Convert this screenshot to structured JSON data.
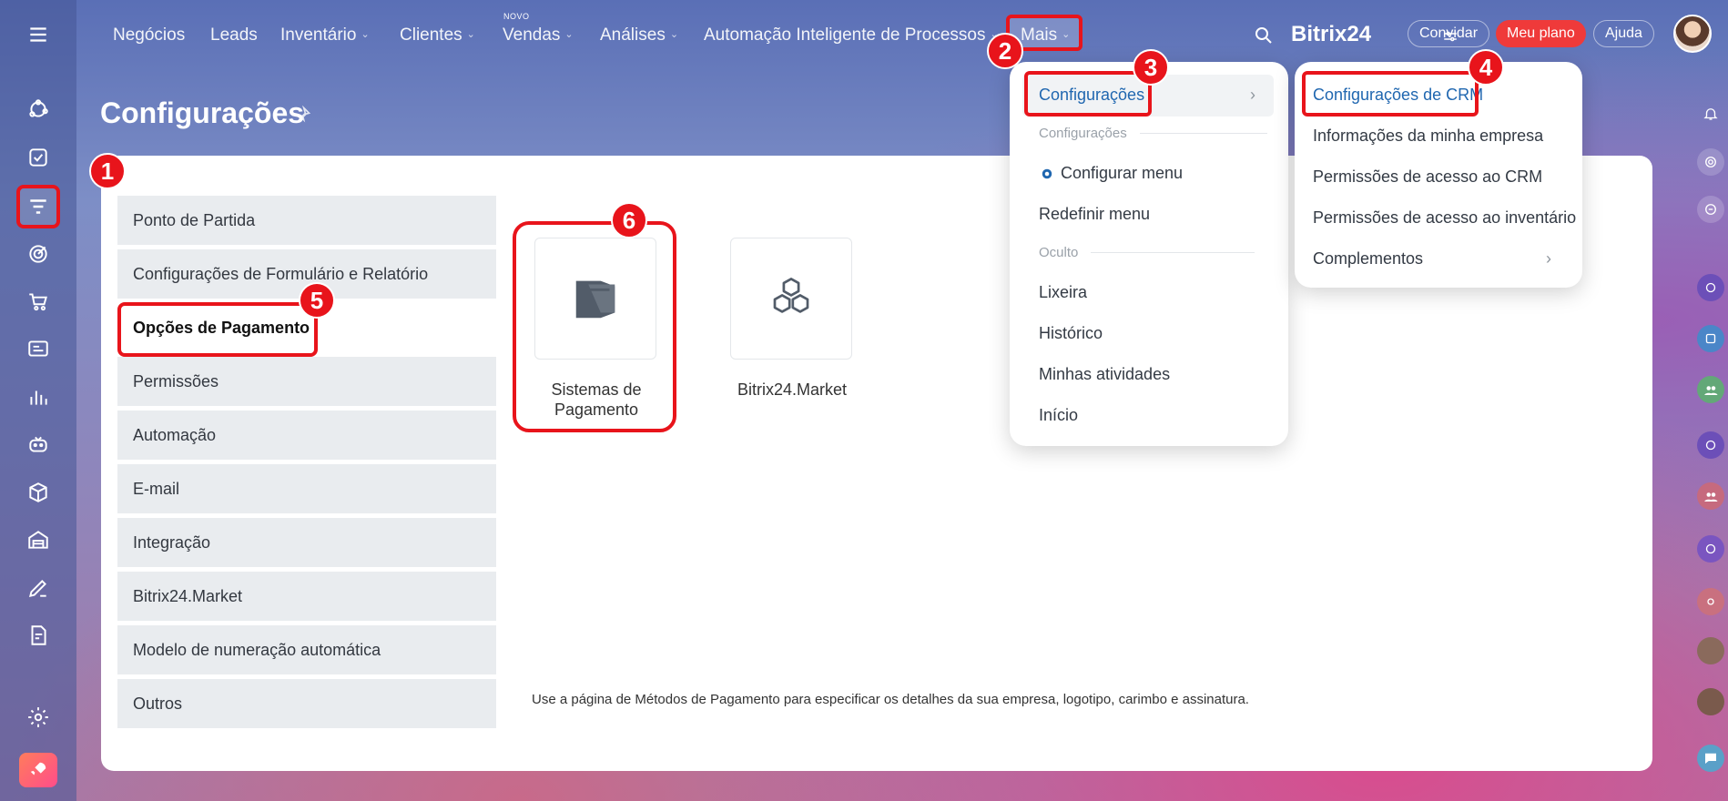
{
  "nav": {
    "items": [
      {
        "label": "Negócios",
        "chevron": false
      },
      {
        "label": "Leads",
        "chevron": false
      },
      {
        "label": "Inventário",
        "chevron": true
      },
      {
        "label": "Clientes",
        "chevron": true
      },
      {
        "label": "Vendas",
        "chevron": true
      },
      {
        "label": "Análises",
        "chevron": true
      },
      {
        "label": "Automação Inteligente de Processos",
        "chevron": true
      },
      {
        "label": "Mais",
        "chevron": true
      }
    ],
    "new_tag": "NOVO",
    "brand": "Bitrix24",
    "invite": "Convidar",
    "plan": "Meu plano",
    "help": "Ajuda"
  },
  "page": {
    "title": "Configurações"
  },
  "menu": {
    "items": [
      "Ponto de Partida",
      "Configurações de Formulário e Relatório",
      "Opções de Pagamento",
      "Permissões",
      "Automação",
      "E-mail",
      "Integração",
      "Bitrix24.Market",
      "Modelo de numeração automática",
      "Outros"
    ],
    "active_index": 2
  },
  "tiles": [
    {
      "label": "Sistemas de Pagamento",
      "icon": "payment-box-icon"
    },
    {
      "label": "Bitrix24.Market",
      "icon": "cubes-icon"
    }
  ],
  "hint": "Use a página de Métodos de Pagamento para especificar os detalhes da sua empresa, logotipo, carimbo e assinatura.",
  "mais_menu": {
    "configuracoes": "Configurações",
    "section_config": "Configurações",
    "configurar_menu": "Configurar menu",
    "redefinir_menu": "Redefinir menu",
    "section_oculto": "Oculto",
    "lixeira": "Lixeira",
    "historico": "Histórico",
    "minhas_atividades": "Minhas atividades",
    "inicio": "Início"
  },
  "sub_menu": {
    "crm_settings": "Configurações de CRM",
    "company_info": "Informações da minha empresa",
    "crm_permissions": "Permissões de acesso ao CRM",
    "inventory_permissions": "Permissões de acesso ao inventário",
    "addons": "Complementos"
  },
  "badges": [
    "1",
    "2",
    "3",
    "4",
    "5",
    "6"
  ],
  "colors": {
    "annotation_red": "#e8141b",
    "link_blue": "#2067b0",
    "plan_red": "#ef3a3a"
  }
}
